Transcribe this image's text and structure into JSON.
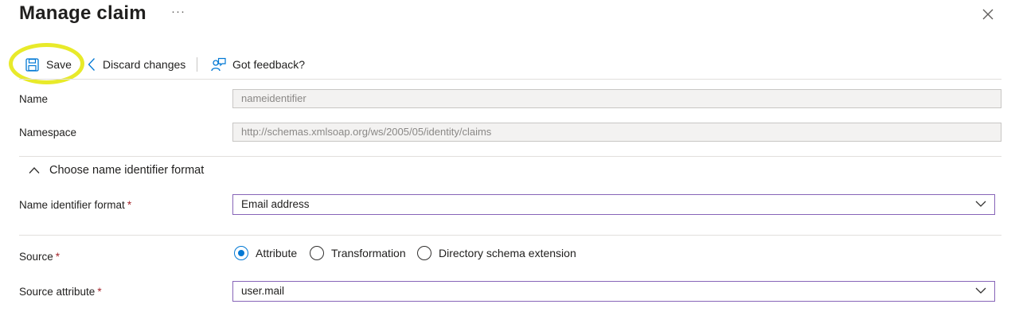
{
  "header": {
    "title": "Manage claim",
    "more": "···",
    "close_icon": "close-icon"
  },
  "toolbar": {
    "save_label": "Save",
    "discard_label": "Discard changes",
    "feedback_label": "Got feedback?",
    "highlight_color": "#e8ea2a"
  },
  "form": {
    "name": {
      "label": "Name",
      "value": "nameidentifier"
    },
    "namespace": {
      "label": "Namespace",
      "value": "http://schemas.xmlsoap.org/ws/2005/05/identity/claims"
    },
    "section_title": "Choose name identifier format",
    "nameid_format": {
      "label": "Name identifier format",
      "required": "*",
      "value": "Email address"
    },
    "source": {
      "label": "Source",
      "required": "*",
      "options": [
        "Attribute",
        "Transformation",
        "Directory schema extension"
      ],
      "selected": "Attribute"
    },
    "source_attribute": {
      "label": "Source attribute",
      "required": "*",
      "value": "user.mail"
    }
  },
  "colors": {
    "accent": "#0078d4",
    "focus_border": "#8764b8",
    "required": "#a4262c"
  }
}
